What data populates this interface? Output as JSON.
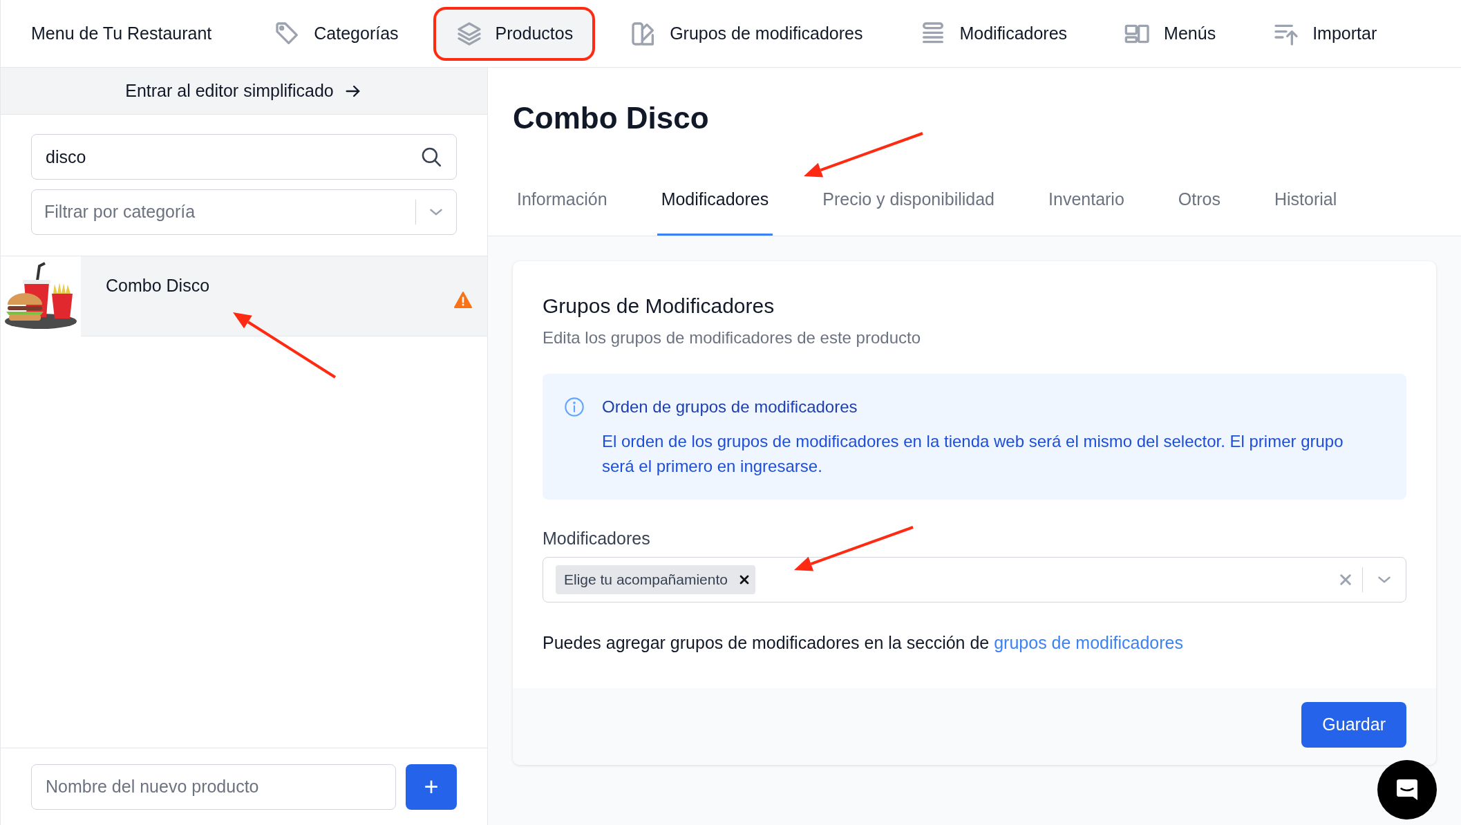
{
  "nav": {
    "title": "Menu de Tu Restaurant",
    "items": [
      {
        "label": "Categorías",
        "selected": false,
        "highlighted": false
      },
      {
        "label": "Productos",
        "selected": true,
        "highlighted": true
      },
      {
        "label": "Grupos de modificadores",
        "selected": false,
        "highlighted": false
      },
      {
        "label": "Modificadores",
        "selected": false,
        "highlighted": false
      },
      {
        "label": "Menús",
        "selected": false,
        "highlighted": false
      },
      {
        "label": "Importar",
        "selected": false,
        "highlighted": false
      }
    ]
  },
  "sidebar": {
    "editor_link": "Entrar al editor simplificado",
    "search": {
      "value": "disco"
    },
    "category_filter": {
      "placeholder": "Filtrar por categoría"
    },
    "products": [
      {
        "name": "Combo Disco",
        "selected": true,
        "warning": true
      }
    ],
    "new_product": {
      "placeholder": "Nombre del nuevo producto"
    },
    "add_button": "+"
  },
  "product": {
    "title": "Combo Disco",
    "tabs": [
      {
        "label": "Información",
        "selected": false
      },
      {
        "label": "Modificadores",
        "selected": true
      },
      {
        "label": "Precio y disponibilidad",
        "selected": false
      },
      {
        "label": "Inventario",
        "selected": false
      },
      {
        "label": "Otros",
        "selected": false
      },
      {
        "label": "Historial",
        "selected": false
      }
    ],
    "card": {
      "heading": "Grupos de Modificadores",
      "subtitle": "Edita los grupos de modificadores de este producto",
      "info": {
        "title": "Orden de grupos de modificadores",
        "text": "El orden de los grupos de modificadores en la tienda web será el mismo del selector. El primer grupo será el primero en ingresarse."
      },
      "field_label": "Modificadores",
      "tags": [
        {
          "label": "Elige tu acompañamiento"
        }
      ],
      "help_text": "Puedes agregar grupos de modificadores en la sección de",
      "help_link": "grupos de modificadores",
      "save_button": "Guardar"
    }
  }
}
